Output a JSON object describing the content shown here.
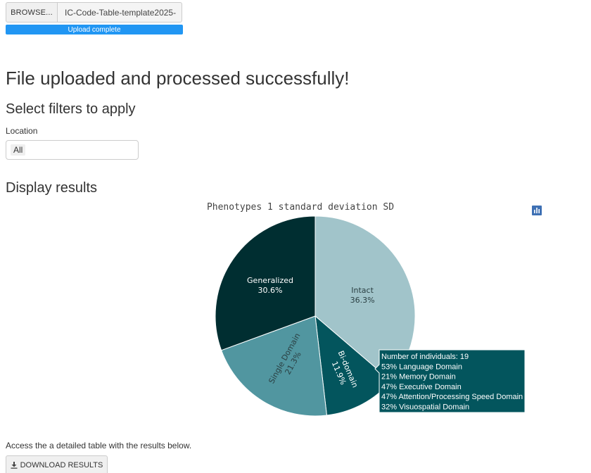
{
  "upload": {
    "browse_label": "BROWSE...",
    "file_name": "IC-Code-Table-template2025-",
    "progress_label": "Upload complete",
    "progress": 1.0
  },
  "main": {
    "success_heading": "File uploaded and processed successfully!",
    "filters_heading": "Select filters to apply",
    "location_label": "Location",
    "location_value": "All",
    "results_heading": "Display results",
    "access_text": "Access the a detailed table with the results below.",
    "download_label": "DOWNLOAD RESULTS"
  },
  "modebar": {
    "icons": [
      "camera-icon",
      "tag-icon",
      "plotly-logo-icon"
    ]
  },
  "chart_data": {
    "type": "pie",
    "title": "Phenotypes  1 standard deviation SD",
    "slices": [
      {
        "label": "Intact",
        "value": 36.3,
        "percent_label": "36.3%",
        "color": "#a1c4ca"
      },
      {
        "label": "Bi-domain",
        "value": 11.9,
        "percent_label": "11.9%",
        "color": "#03555d"
      },
      {
        "label": "Single Domain",
        "value": 21.3,
        "percent_label": "21.3%",
        "color": "#5196a0"
      },
      {
        "label": "Generalized",
        "value": 30.6,
        "percent_label": "30.6%",
        "color": "#002e31"
      }
    ],
    "tooltip": {
      "lines": [
        "Number of individuals: 19",
        "53% Language Domain",
        "21% Memory Domain",
        "47% Executive Domain",
        "47% Attention/Processing Speed Domain",
        "32% Visuospatial Domain"
      ],
      "color": "#03555d"
    }
  }
}
